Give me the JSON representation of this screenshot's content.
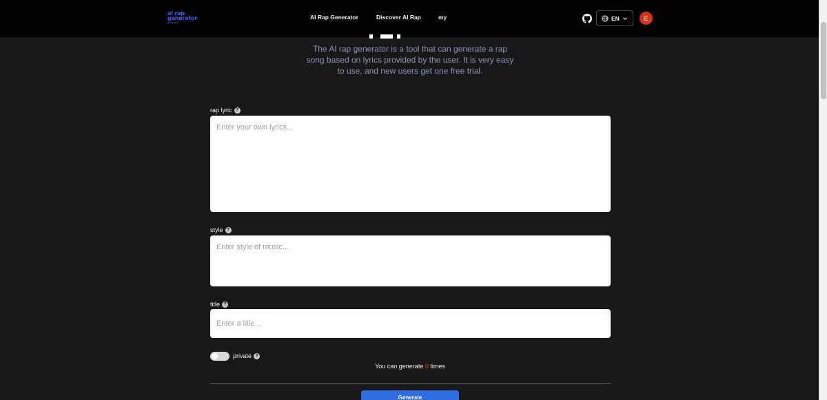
{
  "header": {
    "logo_line1": "ai rap",
    "logo_line2": "generator",
    "logo_small": "generator",
    "nav": [
      "AI Rap Generator",
      "Discover AI Rap",
      "my"
    ],
    "language": "EN",
    "avatar_initial": "E"
  },
  "hero": {
    "description": "The AI rap generator is a tool that can generate a rap song based on lyrics provided by the user. It is very easy to use, and new users get one free trial."
  },
  "form": {
    "lyric_label": "rap lyric",
    "lyric_placeholder": "Enter your own lyrics...",
    "style_label": "style",
    "style_placeholder": "Enter style of music...",
    "title_label": "title",
    "title_placeholder": "Enter a title...",
    "private_label": "private",
    "help_glyph": "?",
    "quota_prefix": "You can generate",
    "quota_count": "0",
    "quota_suffix": "times",
    "generate_label": "Generate"
  },
  "colors": {
    "accent": "#2e6ce0",
    "logo": "#3f5cf0",
    "avatar": "#d9321c",
    "count": "#e5392a"
  },
  "icons": [
    "github-icon",
    "globe-icon",
    "chevron-down-icon",
    "help-icon"
  ]
}
